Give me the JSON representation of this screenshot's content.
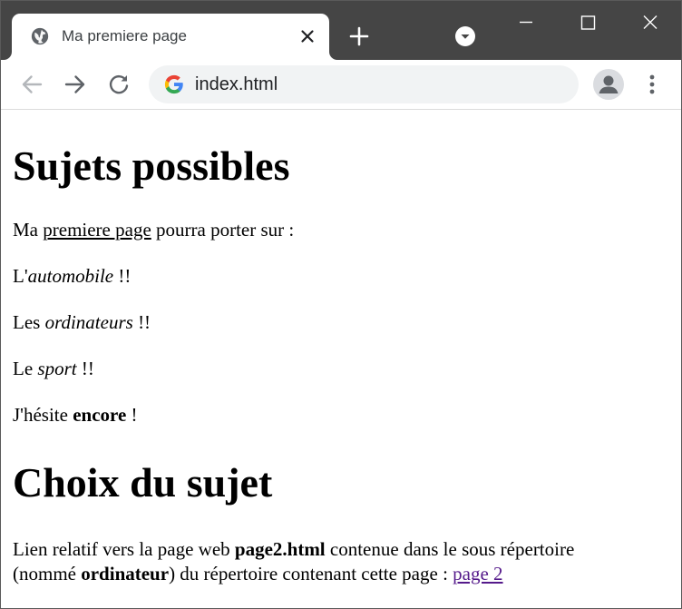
{
  "browser": {
    "tab_title": "Ma premiere page",
    "url": "index.html",
    "colors": {
      "titlebar": "#454545",
      "omnibox": "#f1f3f4",
      "visited_link": "#551a8b"
    },
    "icons": {
      "tab_favicon": "globe-icon",
      "tab_close": "close-icon",
      "new_tab": "plus-icon",
      "tab_search": "dropdown-icon",
      "minimize": "minimize-icon",
      "maximize": "maximize-icon",
      "close": "close-icon",
      "back": "arrow-left-icon",
      "forward": "arrow-right-icon",
      "reload": "reload-icon",
      "site": "google-icon",
      "profile": "person-icon",
      "menu": "kebab-menu-icon"
    }
  },
  "page": {
    "heading1": "Sujets possibles",
    "intro": {
      "before": "Ma ",
      "underlined": "premiere page",
      "after": " pourra porter sur :"
    },
    "topic1": {
      "before": "L'",
      "em": "automobile",
      "after": " !!"
    },
    "topic2": {
      "before": "Les ",
      "em": "ordinateurs",
      "after": " !!"
    },
    "topic3": {
      "before": "Le ",
      "em": "sport",
      "after": " !!"
    },
    "hesitation": {
      "before": "J'hésite ",
      "strong": "encore",
      "after": " !"
    },
    "heading2": "Choix du sujet",
    "choice": {
      "line1_before": "Lien relatif vers la page web ",
      "line1_strong": "page2.html",
      "line1_after": " contenue dans le sous répertoire",
      "line2_before": "(nommé ",
      "line2_strong": "ordinateur",
      "line2_after": ") du répertoire contenant cette page : ",
      "link": "page 2"
    }
  }
}
